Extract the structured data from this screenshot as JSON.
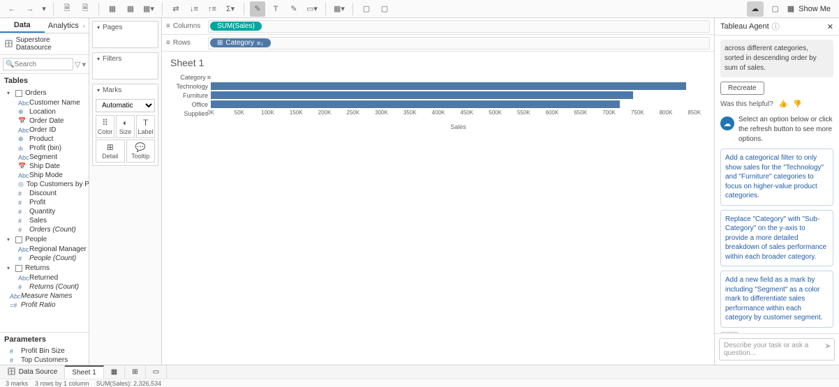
{
  "toolbar": {
    "showme": "Show Me"
  },
  "leftTabs": {
    "data": "Data",
    "analytics": "Analytics"
  },
  "datasource": "Superstore Datasource",
  "search": {
    "placeholder": "Search"
  },
  "tablesHeader": "Tables",
  "tree": {
    "orders": {
      "label": "Orders",
      "items": [
        {
          "ico": "Abc",
          "label": "Customer Name"
        },
        {
          "ico": "⊕",
          "label": "Location"
        },
        {
          "ico": "📅",
          "label": "Order Date"
        },
        {
          "ico": "Abc",
          "label": "Order ID"
        },
        {
          "ico": "⊕",
          "label": "Product"
        },
        {
          "ico": "ılı",
          "label": "Profit (bin)"
        },
        {
          "ico": "Abc",
          "label": "Segment"
        },
        {
          "ico": "📅",
          "label": "Ship Date"
        },
        {
          "ico": "Abc",
          "label": "Ship Mode"
        },
        {
          "ico": "◎",
          "label": "Top Customers by P..."
        },
        {
          "ico": "#",
          "label": "Discount"
        },
        {
          "ico": "#",
          "label": "Profit"
        },
        {
          "ico": "#",
          "label": "Quantity"
        },
        {
          "ico": "#",
          "label": "Sales"
        },
        {
          "ico": "#",
          "label": "Orders (Count)",
          "calc": true
        }
      ]
    },
    "people": {
      "label": "People",
      "items": [
        {
          "ico": "Abc",
          "label": "Regional Manager"
        },
        {
          "ico": "#",
          "label": "People (Count)",
          "calc": true
        }
      ]
    },
    "returns": {
      "label": "Returns",
      "items": [
        {
          "ico": "Abc",
          "label": "Returned"
        },
        {
          "ico": "#",
          "label": "Returns (Count)",
          "calc": true
        }
      ]
    },
    "extra": [
      {
        "ico": "Abc",
        "label": "Measure Names",
        "calc": true
      },
      {
        "ico": "=#",
        "label": "Profit Ratio",
        "calc": true
      }
    ]
  },
  "parametersHeader": "Parameters",
  "parameters": [
    {
      "ico": "#",
      "label": "Profit Bin Size"
    },
    {
      "ico": "#",
      "label": "Top Customers"
    }
  ],
  "cards": {
    "pages": "Pages",
    "filters": "Filters",
    "marks": "Marks",
    "markType": "Automatic",
    "cells": {
      "color": "Color",
      "size": "Size",
      "label": "Label",
      "detail": "Detail",
      "tooltip": "Tooltip"
    }
  },
  "shelves": {
    "columnsLabel": "Columns",
    "rowsLabel": "Rows",
    "columnsPill": "SUM(Sales)",
    "rowsPill": "Category"
  },
  "sheetTitle": "Sheet 1",
  "chart_data": {
    "type": "bar",
    "orientation": "horizontal",
    "title": "Sheet 1",
    "ylabel": "Category",
    "xlabel": "Sales",
    "xlim": [
      0,
      870000
    ],
    "categories": [
      "Technology",
      "Furniture",
      "Office Supplies"
    ],
    "values": [
      836154,
      742000,
      719047
    ],
    "ticks": [
      "0K",
      "50K",
      "100K",
      "150K",
      "200K",
      "250K",
      "300K",
      "350K",
      "400K",
      "450K",
      "500K",
      "550K",
      "600K",
      "650K",
      "700K",
      "750K",
      "800K",
      "850K"
    ]
  },
  "agent": {
    "title": "Tableau Agent",
    "summary": "across different categories, sorted in descending order by sum of sales.",
    "recreate": "Recreate",
    "helpful": "Was this helpful?",
    "prompt": "Select an option below or click the refresh button to see more options.",
    "suggestions": [
      "Add a categorical filter to only show sales for the \"Technology\" and \"Furniture\" categories to focus on higher-value product categories.",
      "Replace \"Category\" with \"Sub-Category\" on the y-axis to provide a more detailed breakdown of sales performance within each broader category.",
      "Add a new field as a mark by including \"Segment\" as a color mark to differentiate sales performance within each category by customer segment."
    ],
    "inputPlaceholder": "Describe your task or ask a question..."
  },
  "bottomTabs": {
    "dataSource": "Data Source",
    "sheet1": "Sheet 1"
  },
  "status": {
    "marks": "3 marks",
    "rows": "3 rows by 1 column",
    "sum": "SUM(Sales): 2,326,534"
  }
}
